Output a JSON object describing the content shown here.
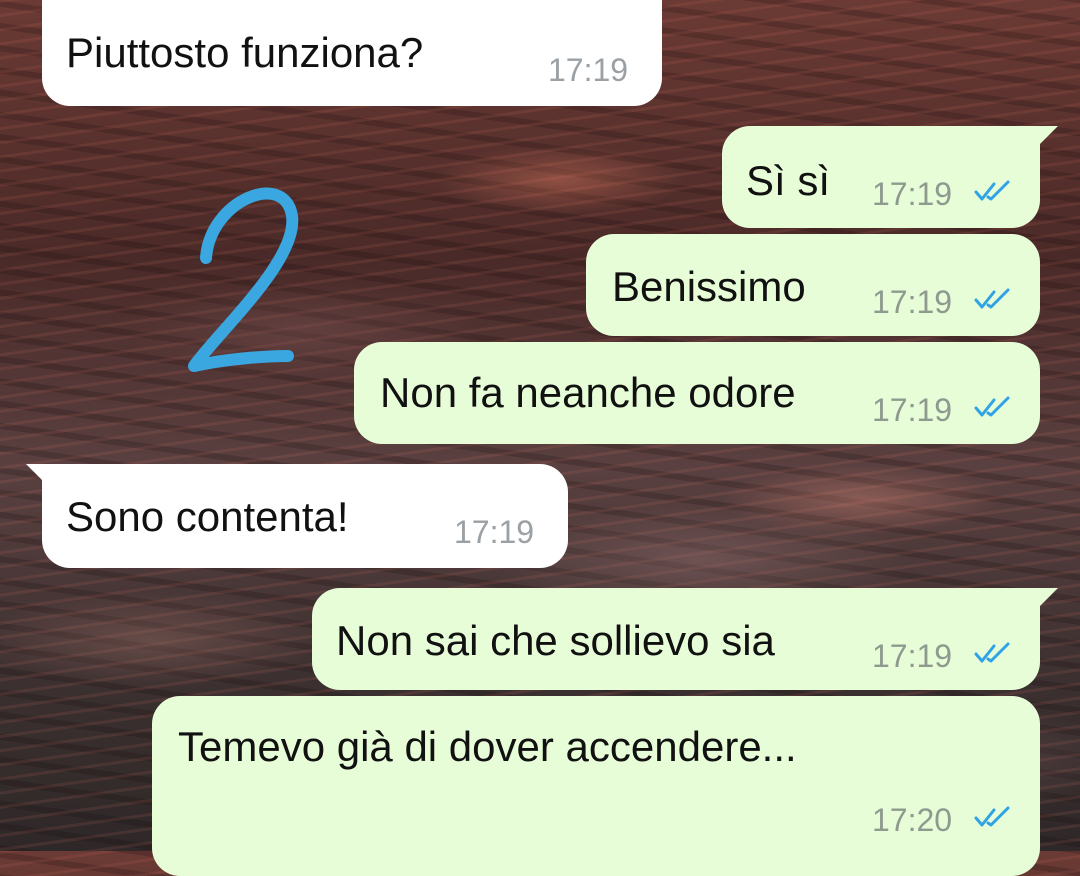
{
  "chat": {
    "messages": [
      {
        "direction": "in",
        "text": "Piuttosto funziona?",
        "time": "17:19"
      },
      {
        "direction": "out",
        "text": "Sì sì",
        "time": "17:19",
        "status": "read"
      },
      {
        "direction": "out",
        "text": "Benissimo",
        "time": "17:19",
        "status": "read"
      },
      {
        "direction": "out",
        "text": "Non fa neanche odore",
        "time": "17:19",
        "status": "read"
      },
      {
        "direction": "in",
        "text": "Sono contenta!",
        "time": "17:19"
      },
      {
        "direction": "out",
        "text": "Non sai che sollievo sia",
        "time": "17:19",
        "status": "read"
      },
      {
        "direction": "out",
        "text": "Temevo già di dover accendere...",
        "time": "17:20",
        "status": "read"
      }
    ]
  },
  "annotation": {
    "text": "2",
    "color": "#3aa7e0"
  },
  "colors": {
    "incoming_bubble": "#ffffff",
    "outgoing_bubble": "#e7fdd8",
    "read_ticks": "#2fa3e6"
  },
  "icons": {
    "read_status": "double-check-icon"
  }
}
